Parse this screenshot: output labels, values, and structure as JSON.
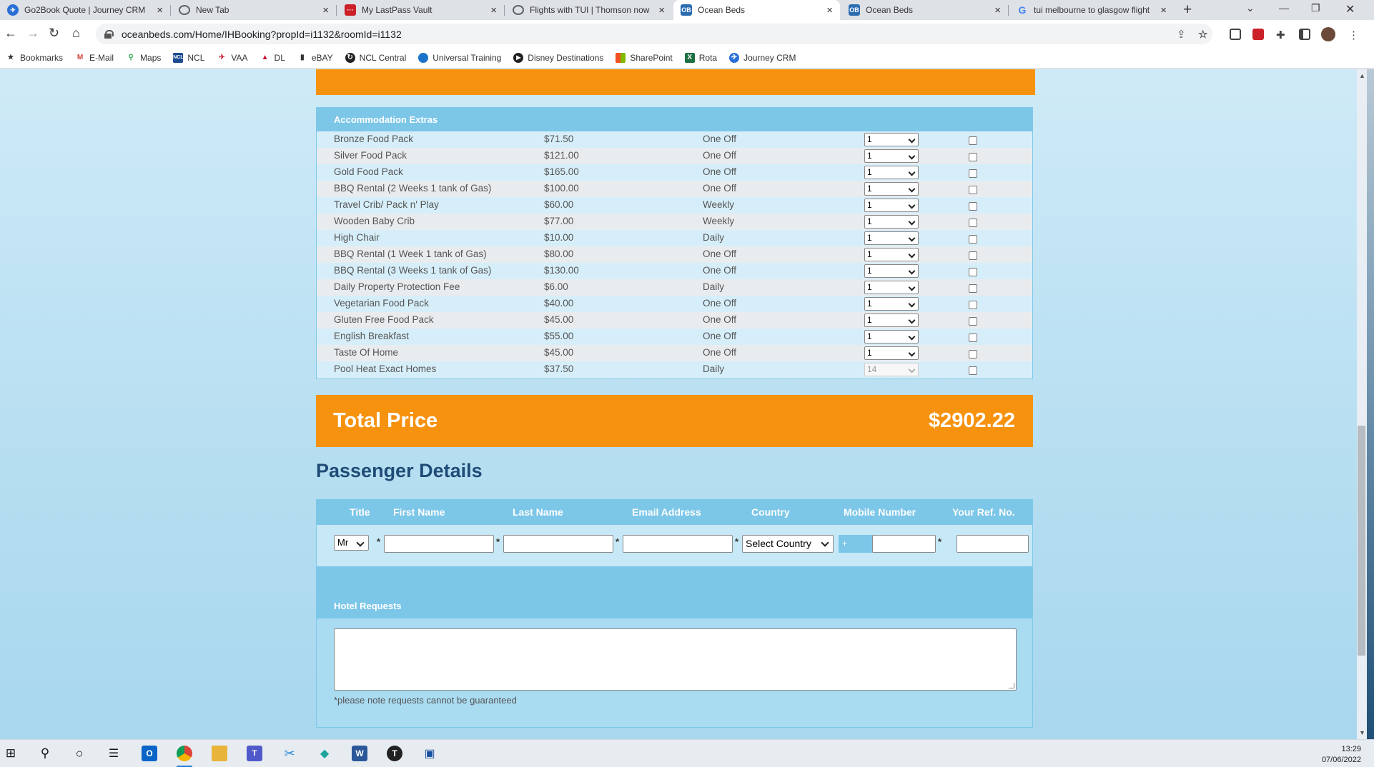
{
  "browser": {
    "tabs": [
      {
        "title": "Go2Book Quote | Journey CRM",
        "icon": "journey-crm-icon",
        "color": "#2a6fd6"
      },
      {
        "title": "New Tab",
        "icon": "chrome-icon",
        "color": "#5f6368"
      },
      {
        "title": "My LastPass Vault",
        "icon": "lastpass-icon",
        "color": "#cc2029"
      },
      {
        "title": "Flights with TUI | Thomson now",
        "icon": "globe-icon",
        "color": "#5f6368"
      },
      {
        "title": "Ocean Beds",
        "icon": "oceanbeds-icon",
        "color": "#2b6cb0",
        "active": true
      },
      {
        "title": "Ocean Beds",
        "icon": "oceanbeds-icon",
        "color": "#2b6cb0"
      },
      {
        "title": "tui melbourne to glasgow flight",
        "icon": "google-icon",
        "color": "#4285f4"
      }
    ],
    "url": "oceanbeds.com/Home/IHBooking?propId=i1132&roomId=i1132",
    "bookmarks": [
      {
        "label": "Bookmarks",
        "icon": "star-icon"
      },
      {
        "label": "E-Mail",
        "icon": "gmail-icon"
      },
      {
        "label": "Maps",
        "icon": "maps-icon"
      },
      {
        "label": "NCL",
        "icon": "ncl-icon"
      },
      {
        "label": "VAA",
        "icon": "vaa-icon"
      },
      {
        "label": "DL",
        "icon": "dl-icon"
      },
      {
        "label": "eBAY",
        "icon": "ebay-icon"
      },
      {
        "label": "NCL Central",
        "icon": "ncl-central-icon"
      },
      {
        "label": "Universal Training",
        "icon": "universal-icon"
      },
      {
        "label": "Disney Destinations",
        "icon": "disney-icon"
      },
      {
        "label": "SharePoint",
        "icon": "sharepoint-icon"
      },
      {
        "label": "Rota",
        "icon": "excel-icon"
      },
      {
        "label": "Journey CRM",
        "icon": "journey-crm-icon"
      }
    ]
  },
  "extras": {
    "heading": "Accommodation Extras",
    "items": [
      {
        "name": "Bronze Food Pack",
        "price": "$71.50",
        "freq": "One Off",
        "qty": "1"
      },
      {
        "name": "Silver Food Pack",
        "price": "$121.00",
        "freq": "One Off",
        "qty": "1"
      },
      {
        "name": "Gold Food Pack",
        "price": "$165.00",
        "freq": "One Off",
        "qty": "1"
      },
      {
        "name": "BBQ Rental (2 Weeks 1 tank of Gas)",
        "price": "$100.00",
        "freq": "One Off",
        "qty": "1"
      },
      {
        "name": "Travel Crib/ Pack n' Play",
        "price": "$60.00",
        "freq": "Weekly",
        "qty": "1"
      },
      {
        "name": "Wooden Baby Crib",
        "price": "$77.00",
        "freq": "Weekly",
        "qty": "1"
      },
      {
        "name": "High Chair",
        "price": "$10.00",
        "freq": "Daily",
        "qty": "1"
      },
      {
        "name": "BBQ Rental (1 Week 1 tank of Gas)",
        "price": "$80.00",
        "freq": "One Off",
        "qty": "1"
      },
      {
        "name": "BBQ Rental (3 Weeks 1 tank of Gas)",
        "price": "$130.00",
        "freq": "One Off",
        "qty": "1"
      },
      {
        "name": "Daily Property Protection Fee",
        "price": "$6.00",
        "freq": "Daily",
        "qty": "1"
      },
      {
        "name": "Vegetarian Food Pack",
        "price": "$40.00",
        "freq": "One Off",
        "qty": "1"
      },
      {
        "name": "Gluten Free Food Pack",
        "price": "$45.00",
        "freq": "One Off",
        "qty": "1"
      },
      {
        "name": "English Breakfast",
        "price": "$55.00",
        "freq": "One Off",
        "qty": "1"
      },
      {
        "name": "Taste Of Home",
        "price": "$45.00",
        "freq": "One Off",
        "qty": "1"
      },
      {
        "name": "Pool Heat Exact Homes",
        "price": "$37.50",
        "freq": "Daily",
        "qty": "14",
        "disabled": true
      }
    ]
  },
  "total": {
    "label": "Total Price",
    "value": "$2902.22"
  },
  "passenger": {
    "heading": "Passenger Details",
    "columns": {
      "title": "Title",
      "first_name": "First Name",
      "last_name": "Last Name",
      "email": "Email Address",
      "country": "Country",
      "mobile": "Mobile Number",
      "ref": "Your Ref. No."
    },
    "title_value": "Mr",
    "country_value": "Select Country",
    "mobile_prefix": "+",
    "required_mark": "*"
  },
  "hotel_requests": {
    "label": "Hotel Requests",
    "note": "*please note requests cannot be guaranteed"
  },
  "taskbar": {
    "time": "13:29",
    "date": "07/06/2022"
  },
  "colors": {
    "orange": "#f7920f",
    "blue_header": "#7cc6e8",
    "title_navy": "#1f4c77"
  }
}
